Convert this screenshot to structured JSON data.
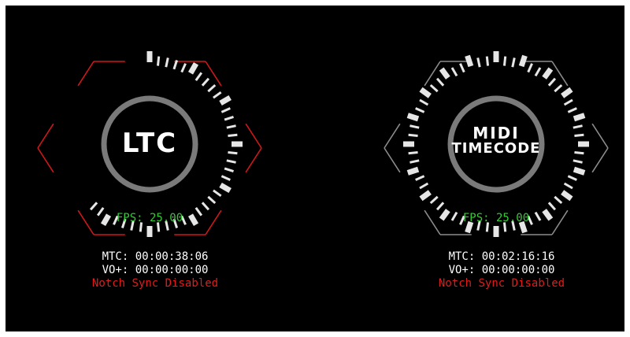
{
  "colors": {
    "background": "#000000",
    "ltc_accent": "#d01818",
    "midi_accent": "#8c8c8c",
    "ring": "#7a7a7a",
    "tick": "#e6e6e6",
    "fps": "#33cc33",
    "text": "#ffffff",
    "warning": "#e01c1c"
  },
  "ltc": {
    "label": "LTC",
    "fps": "FPS: 25.00",
    "mtc": "MTC: 00:00:38:06",
    "vo": "VO+: 00:00:00:00",
    "notch": "Notch Sync Disabled",
    "progress_fraction": 0.633
  },
  "midi": {
    "label_line1": "MIDI",
    "label_line2": "TIMECODE",
    "fps": "FPS: 25.00",
    "mtc": "MTC: 00:02:16:16",
    "vo": "VO+: 00:00:00:00",
    "notch": "Notch Sync Disabled",
    "progress_fraction": 0.267
  }
}
